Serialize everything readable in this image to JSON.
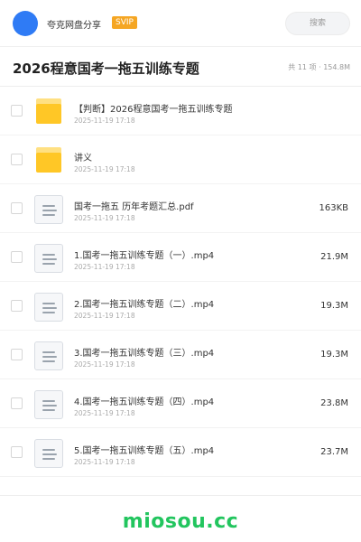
{
  "header": {
    "app_name": "夸克网盘分享",
    "badge": "SVIP",
    "search_placeholder": "搜索"
  },
  "page": {
    "title": "2026程意国考一拖五训练专题",
    "summary": "共 11 项 · 154.8M"
  },
  "files": [
    {
      "type": "folder",
      "icon": "folder-icon",
      "name": "【判断】2026程意国考一拖五训练专题",
      "date": "2025-11-19 17:18",
      "size": ""
    },
    {
      "type": "folder",
      "icon": "folder-icon",
      "name": "讲义",
      "date": "2025-11-19 17:18",
      "size": ""
    },
    {
      "type": "file",
      "icon": "document-icon",
      "name": "国考一拖五 历年考题汇总.pdf",
      "date": "2025-11-19 17:18",
      "size": "163KB"
    },
    {
      "type": "file",
      "icon": "document-icon",
      "name": "1.国考一拖五训练专题（一）.mp4",
      "date": "2025-11-19 17:18",
      "size": "21.9M"
    },
    {
      "type": "file",
      "icon": "document-icon",
      "name": "2.国考一拖五训练专题（二）.mp4",
      "date": "2025-11-19 17:18",
      "size": "19.3M"
    },
    {
      "type": "file",
      "icon": "document-icon",
      "name": "3.国考一拖五训练专题（三）.mp4",
      "date": "2025-11-19 17:18",
      "size": "19.3M"
    },
    {
      "type": "file",
      "icon": "document-icon",
      "name": "4.国考一拖五训练专题（四）.mp4",
      "date": "2025-11-19 17:18",
      "size": "23.8M"
    },
    {
      "type": "file",
      "icon": "document-icon",
      "name": "5.国考一拖五训练专题（五）.mp4",
      "date": "2025-11-19 17:18",
      "size": "23.7M"
    }
  ],
  "footer": {
    "watermark": "miosou.cc"
  },
  "colors": {
    "avatar": "#2f7bf5",
    "badge": "#f5a623",
    "folder": "#ffc726",
    "watermark": "#22c55e"
  }
}
